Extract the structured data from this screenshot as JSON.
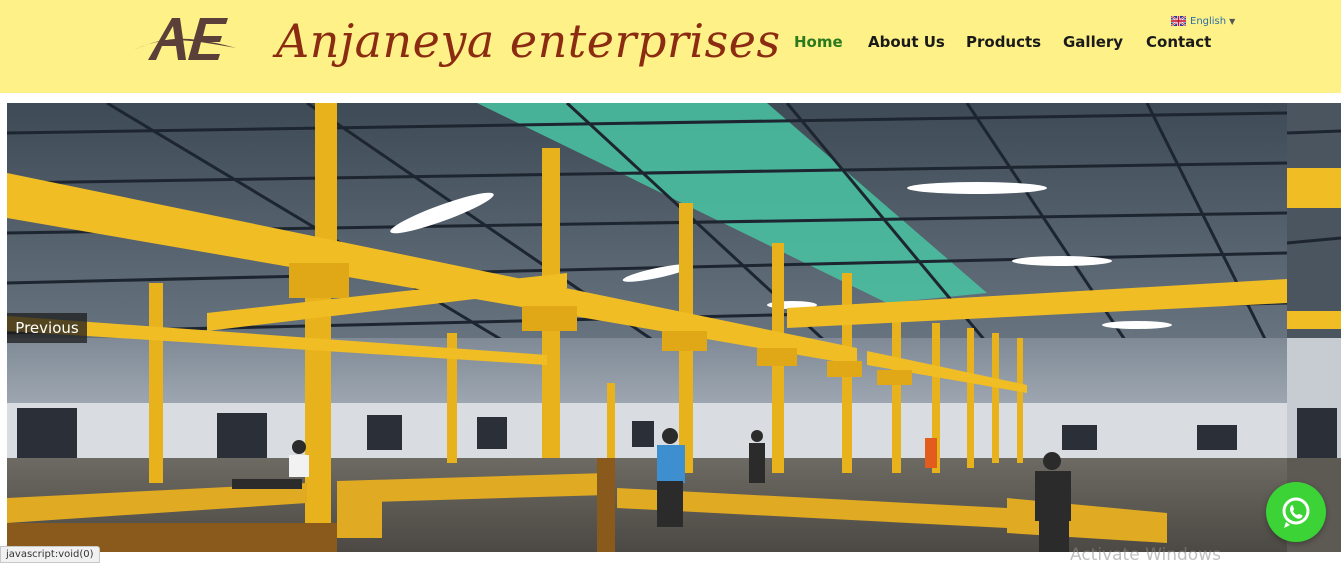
{
  "header": {
    "logo_text": "AE",
    "brand": "Anjaneya enterprises",
    "nav": [
      {
        "label": "Home",
        "active": true
      },
      {
        "label": "About Us",
        "active": false
      },
      {
        "label": "Products",
        "active": false
      },
      {
        "label": "Gallery",
        "active": false
      },
      {
        "label": "Contact",
        "active": false
      }
    ],
    "language": "English"
  },
  "slider": {
    "prev_label": "Previous",
    "image_description_icon": "factory-hall-photo"
  },
  "status_bar": {
    "text": "javascript:void(0)"
  },
  "watermark": {
    "text": "Activate Windows"
  },
  "whatsapp": {
    "icon": "whatsapp-icon"
  },
  "colors": {
    "header_bg": "#fdf187",
    "brand": "#8a2b12",
    "nav_active": "#2b7a1e",
    "nav": "#1a1a1a",
    "whatsapp": "#3bd335",
    "beam_yellow": "#e8b21c"
  }
}
